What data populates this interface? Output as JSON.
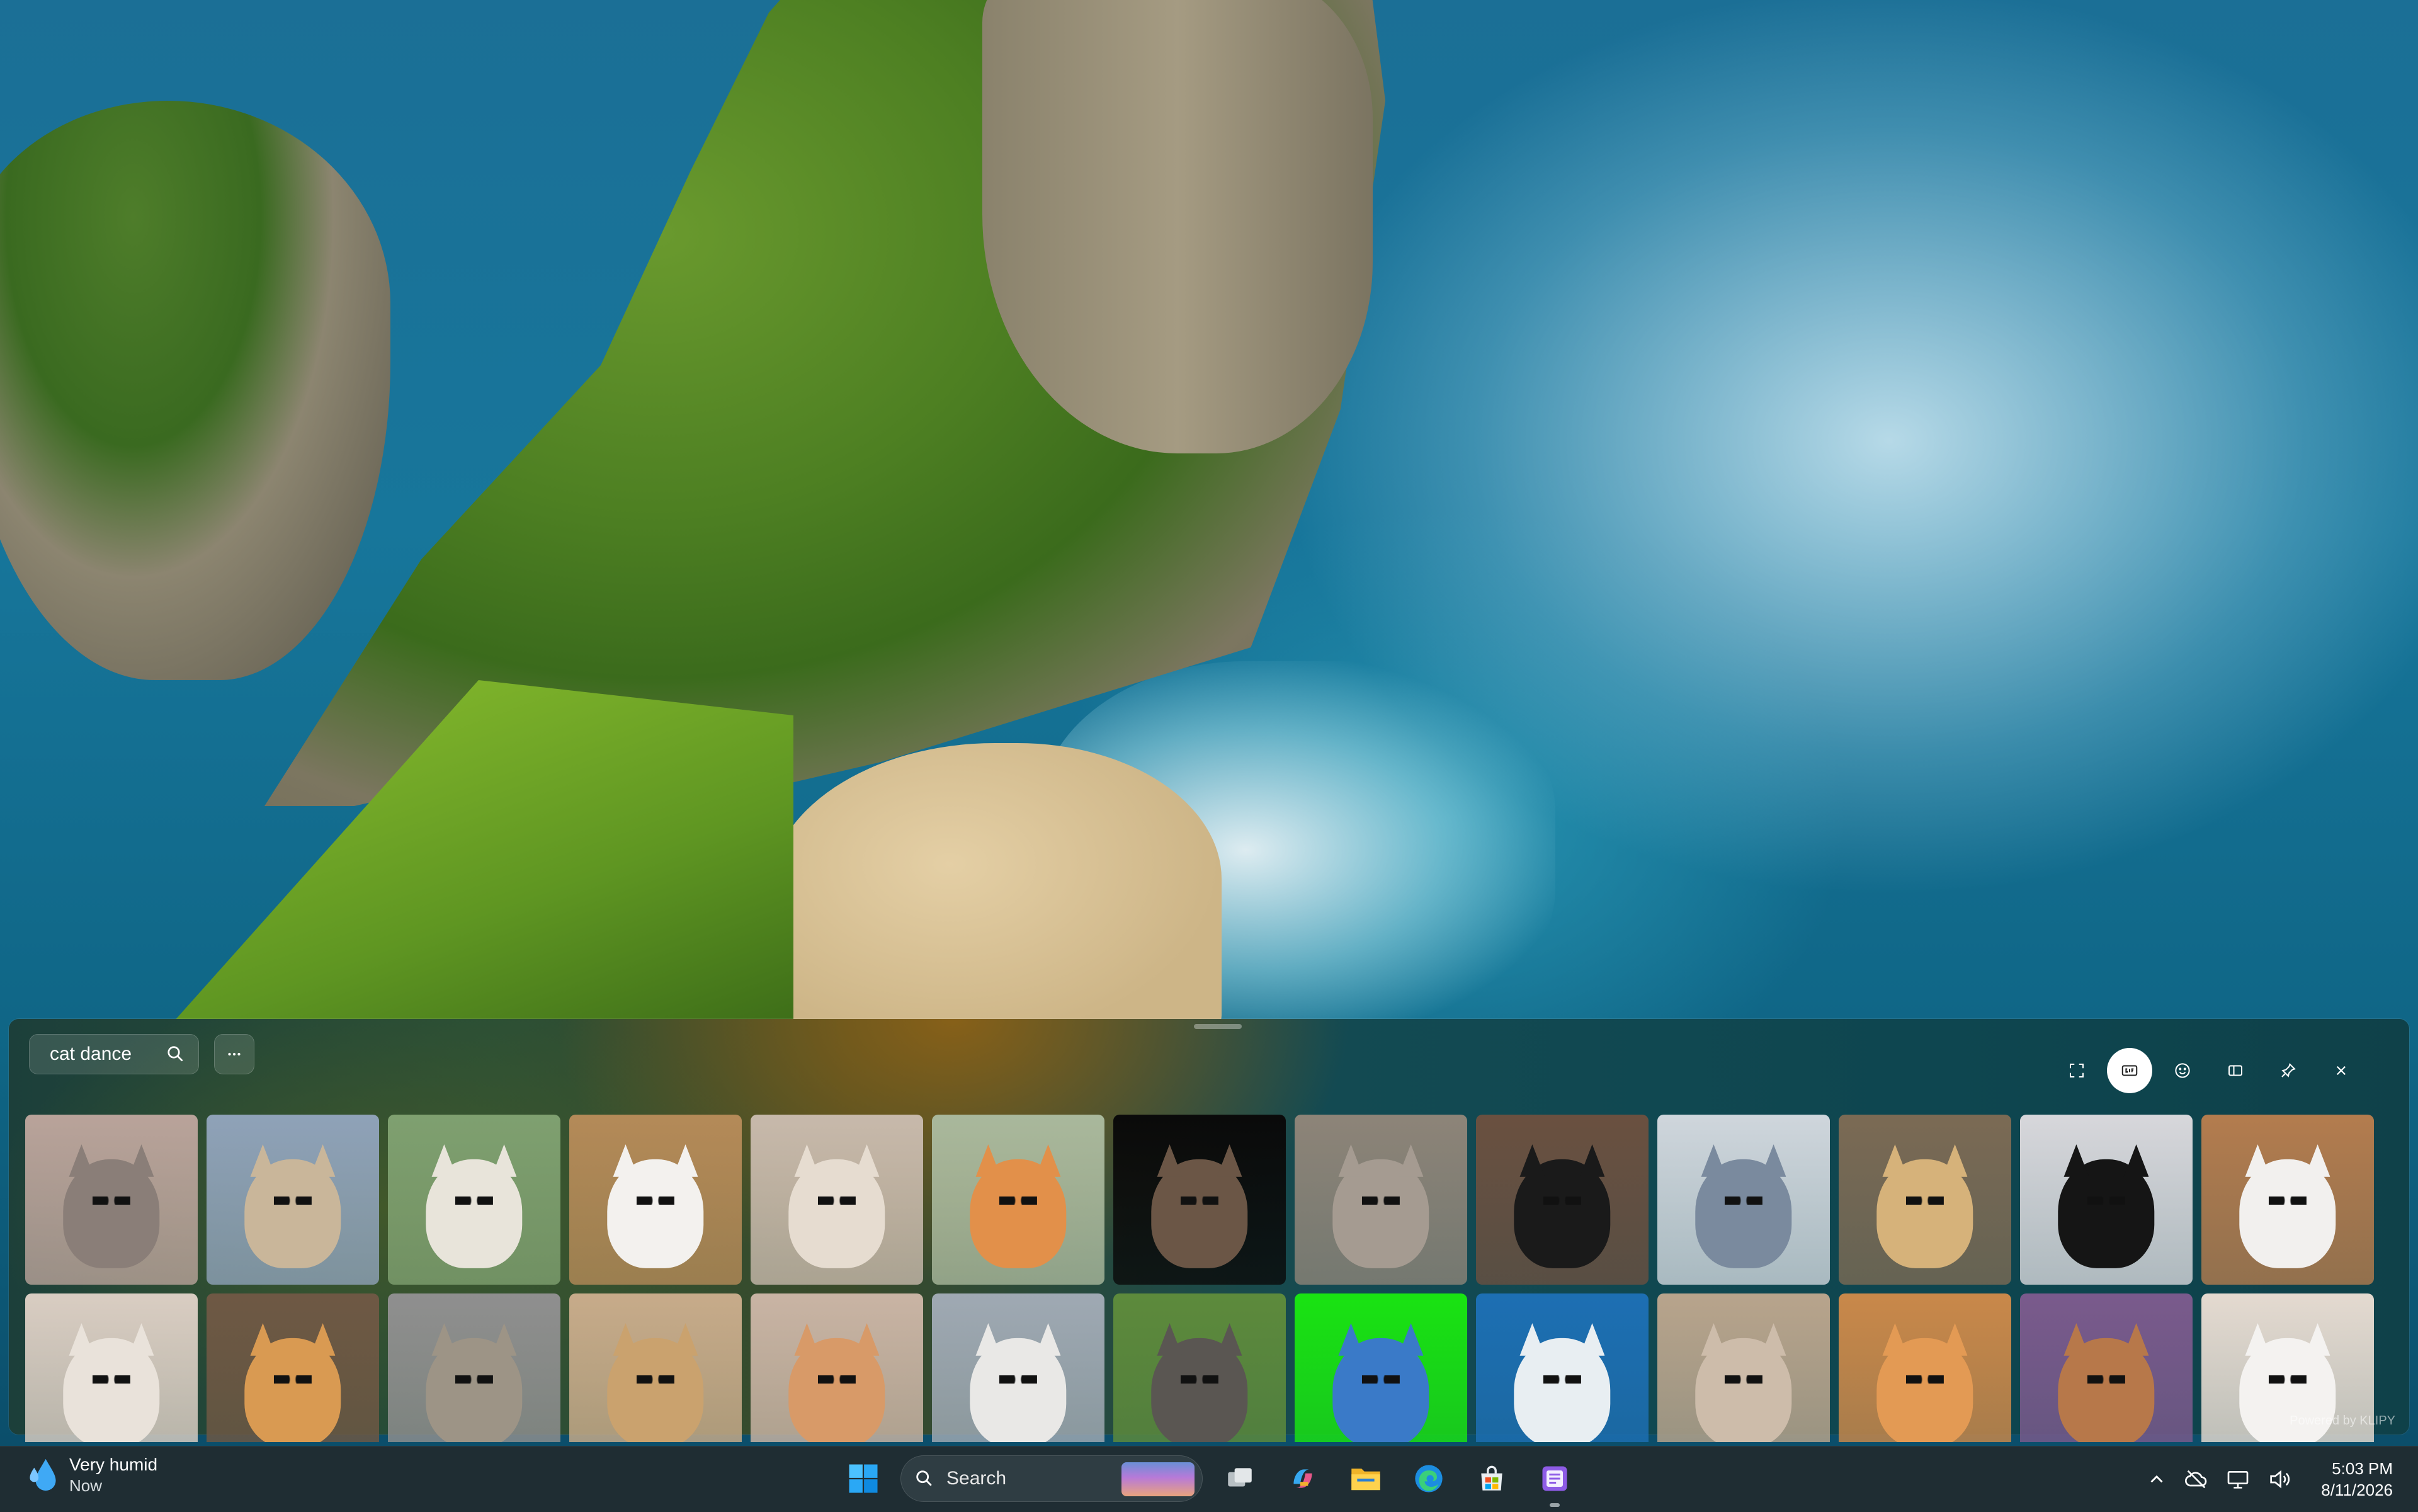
{
  "panel": {
    "search": {
      "value": "cat dance",
      "placeholder": ""
    },
    "more_label": "...",
    "powered_by": "Powered by KLIPY",
    "toolbar": [
      {
        "name": "resize-icon",
        "active": false
      },
      {
        "name": "gif-icon",
        "active": true
      },
      {
        "name": "emoji-icon",
        "active": false
      },
      {
        "name": "dock-icon",
        "active": false
      },
      {
        "name": "pin-icon",
        "active": false
      },
      {
        "name": "close-icon",
        "active": false
      }
    ],
    "results": [
      {
        "bg": "#b9a39a",
        "cat": "#8a7e78"
      },
      {
        "bg": "#8fa2b8",
        "cat": "#c9b69a"
      },
      {
        "bg": "#7fa070",
        "cat": "#e8e4da"
      },
      {
        "bg": "#b48a58",
        "cat": "#f3f1ee"
      },
      {
        "bg": "#c7b9ab",
        "cat": "#e6dcd0"
      },
      {
        "bg": "#a9b89c",
        "cat": "#e2904a"
      },
      {
        "bg": "#0a0a0a",
        "cat": "#6b5646"
      },
      {
        "bg": "#8d8478",
        "cat": "#a59b91"
      },
      {
        "bg": "#6a5040",
        "cat": "#1a1a1a"
      },
      {
        "bg": "#cfd6dc",
        "cat": "#7a8a9e"
      },
      {
        "bg": "#7b6a54",
        "cat": "#d6b27a"
      },
      {
        "bg": "#d7d7db",
        "cat": "#151515"
      },
      {
        "bg": "#b37c4e",
        "cat": "#f2f0ee"
      },
      {
        "bg": "#d9cdc2",
        "cat": "#e9e2da"
      },
      {
        "bg": "#6e5844",
        "cat": "#d99a52"
      },
      {
        "bg": "#8f8f8f",
        "cat": "#9d9486"
      },
      {
        "bg": "#c7ab8a",
        "cat": "#caa26e"
      },
      {
        "bg": "#c9b4a4",
        "cat": "#d89a68"
      },
      {
        "bg": "#9fa9b3",
        "cat": "#e9e8e6"
      },
      {
        "bg": "#5d8a3c",
        "cat": "#5a5652"
      },
      {
        "bg": "#19e312",
        "cat": "#3a7ac8"
      },
      {
        "bg": "#1d6fb3",
        "cat": "#e8eef2"
      },
      {
        "bg": "#b8a48c",
        "cat": "#cdbcaa"
      },
      {
        "bg": "#c9884a",
        "cat": "#e39a54"
      },
      {
        "bg": "#7a5a8c",
        "cat": "#b7784a"
      },
      {
        "bg": "#e4dad0",
        "cat": "#f4f2f0"
      }
    ]
  },
  "taskbar": {
    "weather": {
      "condition": "Very humid",
      "time": "Now"
    },
    "search_label": "Search",
    "apps": [
      "task-view-icon",
      "copilot-icon",
      "file-explorer-icon",
      "edge-icon",
      "store-icon",
      "notepad-icon"
    ],
    "tray": {
      "time": "5:03 PM",
      "date": "8/11/2026"
    }
  }
}
